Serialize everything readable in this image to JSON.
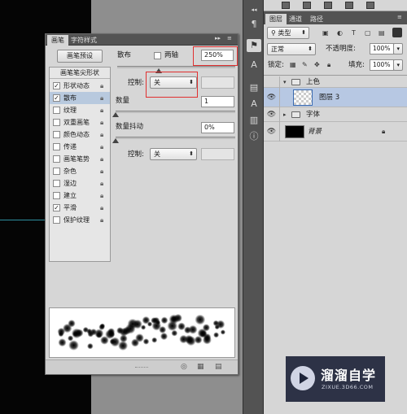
{
  "brush_panel": {
    "tabs": [
      "画笔",
      "字符样式"
    ],
    "preset_button": "画笔预设",
    "list_header": "画笔笔尖形状",
    "items": [
      {
        "label": "形状动态",
        "checked": true,
        "selected": false
      },
      {
        "label": "散布",
        "checked": true,
        "selected": true
      },
      {
        "label": "纹理",
        "checked": false,
        "selected": false
      },
      {
        "label": "双重画笔",
        "checked": false,
        "selected": false
      },
      {
        "label": "颜色动态",
        "checked": false,
        "selected": false
      },
      {
        "label": "传递",
        "checked": false,
        "selected": false
      },
      {
        "label": "画笔笔势",
        "checked": false,
        "selected": false
      },
      {
        "label": "杂色",
        "checked": false,
        "selected": false
      },
      {
        "label": "湿边",
        "checked": false,
        "selected": false
      },
      {
        "label": "建立",
        "checked": false,
        "selected": false
      },
      {
        "label": "平滑",
        "checked": true,
        "selected": false
      },
      {
        "label": "保护纹理",
        "checked": false,
        "selected": false
      }
    ],
    "scatter_label": "散布",
    "both_axes_label": "两轴",
    "both_axes_checked": false,
    "scatter_value": "250%",
    "scatter_level": 0.35,
    "control_label": "控制:",
    "control_value": "关",
    "count_label": "数量",
    "count_value": "1",
    "count_level": 0.0,
    "jitter_label": "数量抖动",
    "jitter_value": "0%",
    "jitter_level": 0.0,
    "control2_label": "控制:",
    "control2_value": "关"
  },
  "layers_panel": {
    "tabs": [
      "图层",
      "通道",
      "路径"
    ],
    "filter_label": "类型",
    "blend_mode": "正常",
    "opacity_label": "不透明度:",
    "opacity_value": "100%",
    "lock_label": "锁定:",
    "fill_label": "填充:",
    "fill_value": "100%",
    "layers": [
      {
        "name": "上色",
        "kind": "group-open",
        "visible": false,
        "selected": false
      },
      {
        "name": "图层 3",
        "kind": "layer-transparent",
        "visible": true,
        "selected": true
      },
      {
        "name": "字体",
        "kind": "group-closed",
        "visible": true,
        "selected": false
      },
      {
        "name": "背景",
        "kind": "background",
        "visible": true,
        "selected": false,
        "locked": true
      }
    ]
  },
  "icons": {
    "lock": "lock-icon",
    "eye": "eye-icon",
    "folder": "folder-icon"
  },
  "colors": {
    "selection_blue": "#b7c8e3",
    "highlight_red": "#e03030",
    "panel_gray": "#d6d6d6"
  },
  "watermark": {
    "title": "溜溜自学",
    "url": "ZIXUE.3D66.COM"
  }
}
